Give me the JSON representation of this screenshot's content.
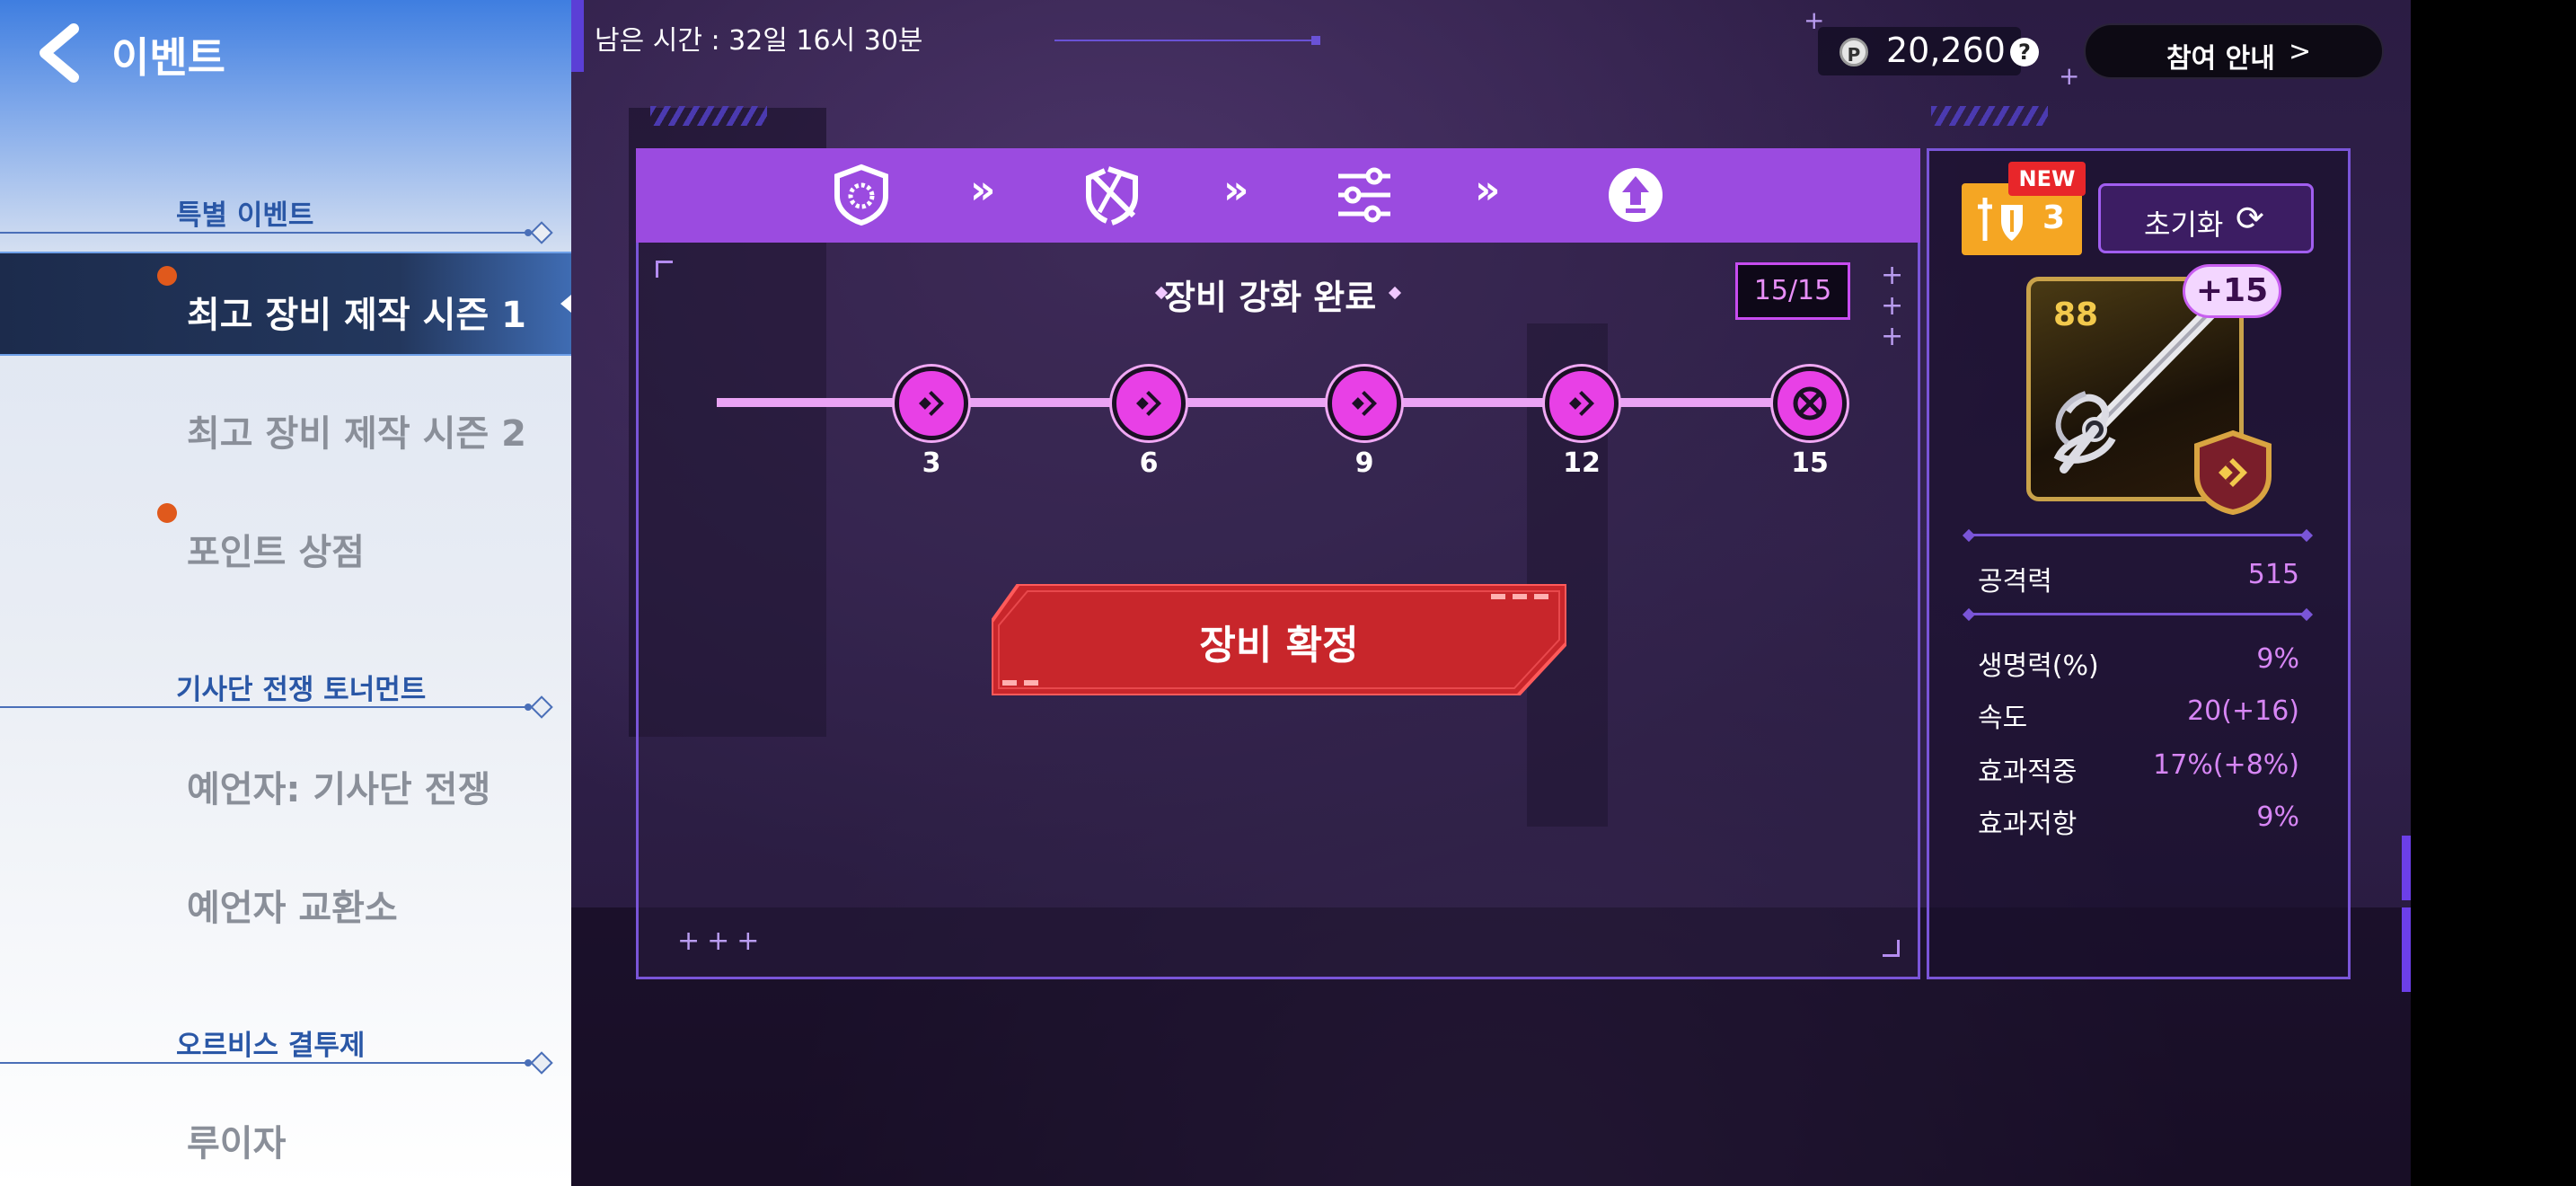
{
  "sidebar": {
    "title": "이벤트",
    "sections": [
      {
        "heading": "특별 이벤트"
      },
      {
        "heading": "기사단 전쟁 토너먼트"
      },
      {
        "heading": "오르비스 결투제"
      }
    ],
    "items": [
      {
        "label": "최고 장비 제작 시즌 1"
      },
      {
        "label": "최고 장비 제작 시즌 2"
      },
      {
        "label": "포인트 상점"
      },
      {
        "label": "예언자: 기사단 전쟁"
      },
      {
        "label": "예언자 교환소"
      },
      {
        "label": "루이자"
      }
    ]
  },
  "topbar": {
    "timer": "남은 시간 : 32일 16시 30분",
    "currency": {
      "icon": "p-coin-icon",
      "symbol": "P",
      "value": "20,260"
    },
    "help_symbol": "?",
    "guide_label": "참여 안내",
    "guide_chevron": ">"
  },
  "steps": [
    {
      "icon": "shield-icon"
    },
    {
      "icon": "broken-shield-icon"
    },
    {
      "icon": "sliders-icon"
    },
    {
      "icon": "upgrade-arrow-icon"
    }
  ],
  "step_separator": "»",
  "progress": {
    "title": "장비 강화 완료",
    "count": "15/15",
    "milestones": [
      "3",
      "6",
      "9",
      "12",
      "15"
    ]
  },
  "confirm_label": "장비 확정",
  "item": {
    "buff_count": "3",
    "new_label": "NEW",
    "reset_label": "초기화",
    "reset_icon": "⟳",
    "level": "88",
    "enhance": "+15",
    "stats": [
      {
        "name": "공격력",
        "value": "515"
      },
      {
        "name": "생명력(%)",
        "value": "9%"
      },
      {
        "name": "속도",
        "value": "20(+16)"
      },
      {
        "name": "효과적중",
        "value": "17%(+8%)"
      },
      {
        "name": "효과저항",
        "value": "9%"
      }
    ]
  },
  "colors": {
    "accent_purple": "#9b4be0",
    "node_magenta": "#e840e6",
    "confirm_red": "#c8262b",
    "stat_value": "#d786f5",
    "notification_dot": "#e0591c"
  }
}
